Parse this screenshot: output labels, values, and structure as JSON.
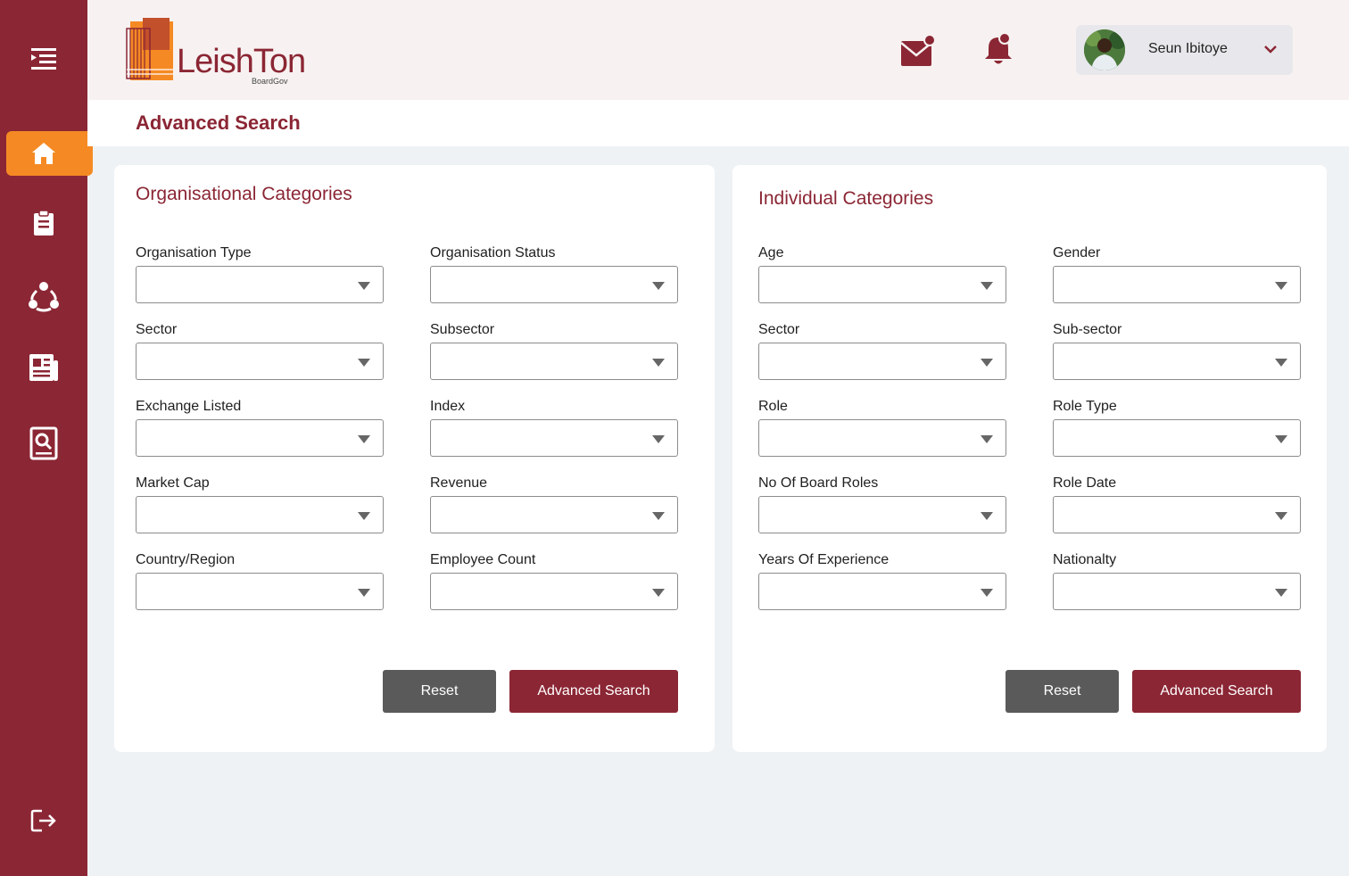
{
  "app": {
    "logo_text": "LeishTon",
    "logo_sub": "BoardGov"
  },
  "header": {
    "user_name": "Seun Ibitoye"
  },
  "page": {
    "title": "Advanced Search"
  },
  "organisational": {
    "title": "Organisational Categories",
    "fields": [
      {
        "label": "Organisation Type",
        "value": ""
      },
      {
        "label": "Organisation Status",
        "value": ""
      },
      {
        "label": "Sector",
        "value": ""
      },
      {
        "label": "Subsector",
        "value": ""
      },
      {
        "label": "Exchange Listed",
        "value": ""
      },
      {
        "label": "Index",
        "value": ""
      },
      {
        "label": "Market Cap",
        "value": ""
      },
      {
        "label": "Revenue",
        "value": ""
      },
      {
        "label": "Country/Region",
        "value": ""
      },
      {
        "label": "Employee Count",
        "value": ""
      }
    ],
    "reset_label": "Reset",
    "search_label": "Advanced Search"
  },
  "individual": {
    "title": "Individual Categories",
    "fields": [
      {
        "label": "Age",
        "value": ""
      },
      {
        "label": "Gender",
        "value": ""
      },
      {
        "label": "Sector",
        "value": ""
      },
      {
        "label": "Sub-sector",
        "value": ""
      },
      {
        "label": "Role",
        "value": ""
      },
      {
        "label": "Role Type",
        "value": ""
      },
      {
        "label": "No Of Board Roles",
        "value": ""
      },
      {
        "label": "Role Date",
        "value": ""
      },
      {
        "label": "Years Of Experience",
        "value": ""
      },
      {
        "label": "Nationalty",
        "value": ""
      }
    ],
    "reset_label": "Reset",
    "search_label": "Advanced Search"
  },
  "sidebar": {
    "icons": [
      "menu-icon",
      "home-icon",
      "clipboard-icon",
      "people-icon",
      "newspaper-icon",
      "document-search-icon",
      "logout-icon"
    ]
  },
  "colors": {
    "brand": "#8b2634",
    "accent": "#f58a24",
    "reset_button": "#5a5a5a"
  }
}
